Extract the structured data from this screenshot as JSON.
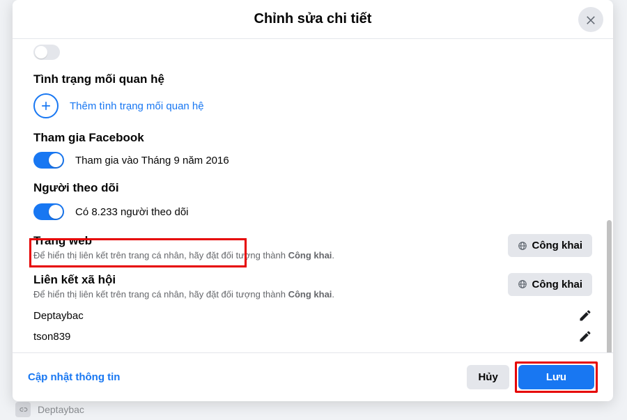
{
  "modal": {
    "title": "Chỉnh sửa chi tiết",
    "close_icon": "close"
  },
  "sections": {
    "relationship": {
      "title": "Tình trạng mối quan hệ",
      "add_label": "Thêm tình trạng mối quan hệ"
    },
    "joined": {
      "title": "Tham gia Facebook",
      "text": "Tham gia vào Tháng 9 năm 2016",
      "toggle_on": true
    },
    "followers": {
      "title": "Người theo dõi",
      "text": "Có 8.233 người theo dõi",
      "toggle_on": true
    },
    "website": {
      "title": "Trang web",
      "subtitle_pre": "Để hiển thị liên kết trên trang cá nhân, hãy đặt đối tượng thành ",
      "subtitle_bold": "Công khai",
      "audience_label": "Công khai"
    },
    "social": {
      "title": "Liên kết xã hội",
      "subtitle_pre": "Để hiển thị liên kết trên trang cá nhân, hãy đặt đối tượng thành ",
      "subtitle_bold": "Công khai",
      "audience_label": "Công khai",
      "links": [
        "Deptaybac",
        "tson839"
      ]
    }
  },
  "footer": {
    "update_label": "Cập nhật thông tin",
    "cancel_label": "Hủy",
    "save_label": "Lưu"
  },
  "background_hint": "Deptaybac"
}
